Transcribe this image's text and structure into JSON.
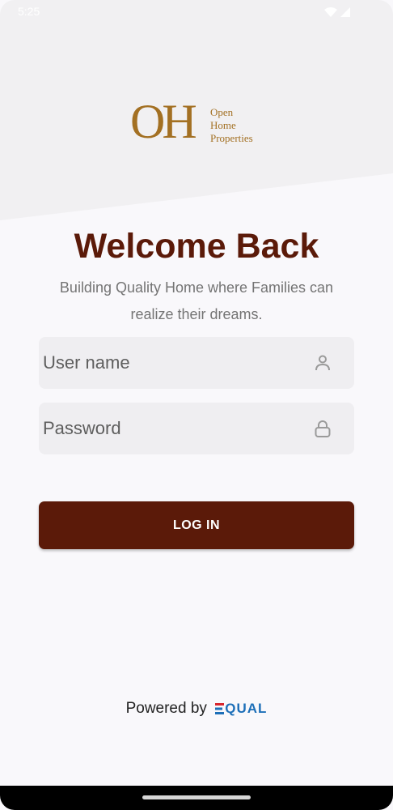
{
  "status_bar": {
    "time": "5:25",
    "icons": [
      "wifi-icon",
      "cell-signal-icon"
    ]
  },
  "logo": {
    "monogram": "OH",
    "line1": "Open",
    "line2": "Home",
    "line3": "Properties",
    "color": "#a37023"
  },
  "title": "Welcome Back",
  "subtitle": "Building Quality Home where Families can realize their dreams.",
  "form": {
    "username_placeholder": "User name",
    "username_icon": "person-icon",
    "password_placeholder": "Password",
    "password_icon": "lock-icon",
    "login_label": "LOG IN"
  },
  "footer": {
    "powered_by": "Powered by",
    "brand": "EQUAL"
  },
  "colors": {
    "primary": "#5b1a09",
    "logo_gold": "#a37023",
    "brand_blue": "#1d6fb8",
    "brand_red": "#d8262e"
  }
}
